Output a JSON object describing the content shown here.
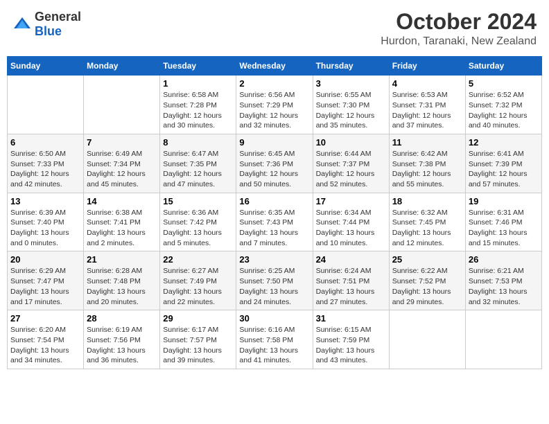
{
  "logo": {
    "general": "General",
    "blue": "Blue"
  },
  "title": "October 2024",
  "subtitle": "Hurdon, Taranaki, New Zealand",
  "header_days": [
    "Sunday",
    "Monday",
    "Tuesday",
    "Wednesday",
    "Thursday",
    "Friday",
    "Saturday"
  ],
  "weeks": [
    [
      {
        "day": "",
        "info": ""
      },
      {
        "day": "",
        "info": ""
      },
      {
        "day": "1",
        "info": "Sunrise: 6:58 AM\nSunset: 7:28 PM\nDaylight: 12 hours and 30 minutes."
      },
      {
        "day": "2",
        "info": "Sunrise: 6:56 AM\nSunset: 7:29 PM\nDaylight: 12 hours and 32 minutes."
      },
      {
        "day": "3",
        "info": "Sunrise: 6:55 AM\nSunset: 7:30 PM\nDaylight: 12 hours and 35 minutes."
      },
      {
        "day": "4",
        "info": "Sunrise: 6:53 AM\nSunset: 7:31 PM\nDaylight: 12 hours and 37 minutes."
      },
      {
        "day": "5",
        "info": "Sunrise: 6:52 AM\nSunset: 7:32 PM\nDaylight: 12 hours and 40 minutes."
      }
    ],
    [
      {
        "day": "6",
        "info": "Sunrise: 6:50 AM\nSunset: 7:33 PM\nDaylight: 12 hours and 42 minutes."
      },
      {
        "day": "7",
        "info": "Sunrise: 6:49 AM\nSunset: 7:34 PM\nDaylight: 12 hours and 45 minutes."
      },
      {
        "day": "8",
        "info": "Sunrise: 6:47 AM\nSunset: 7:35 PM\nDaylight: 12 hours and 47 minutes."
      },
      {
        "day": "9",
        "info": "Sunrise: 6:45 AM\nSunset: 7:36 PM\nDaylight: 12 hours and 50 minutes."
      },
      {
        "day": "10",
        "info": "Sunrise: 6:44 AM\nSunset: 7:37 PM\nDaylight: 12 hours and 52 minutes."
      },
      {
        "day": "11",
        "info": "Sunrise: 6:42 AM\nSunset: 7:38 PM\nDaylight: 12 hours and 55 minutes."
      },
      {
        "day": "12",
        "info": "Sunrise: 6:41 AM\nSunset: 7:39 PM\nDaylight: 12 hours and 57 minutes."
      }
    ],
    [
      {
        "day": "13",
        "info": "Sunrise: 6:39 AM\nSunset: 7:40 PM\nDaylight: 13 hours and 0 minutes."
      },
      {
        "day": "14",
        "info": "Sunrise: 6:38 AM\nSunset: 7:41 PM\nDaylight: 13 hours and 2 minutes."
      },
      {
        "day": "15",
        "info": "Sunrise: 6:36 AM\nSunset: 7:42 PM\nDaylight: 13 hours and 5 minutes."
      },
      {
        "day": "16",
        "info": "Sunrise: 6:35 AM\nSunset: 7:43 PM\nDaylight: 13 hours and 7 minutes."
      },
      {
        "day": "17",
        "info": "Sunrise: 6:34 AM\nSunset: 7:44 PM\nDaylight: 13 hours and 10 minutes."
      },
      {
        "day": "18",
        "info": "Sunrise: 6:32 AM\nSunset: 7:45 PM\nDaylight: 13 hours and 12 minutes."
      },
      {
        "day": "19",
        "info": "Sunrise: 6:31 AM\nSunset: 7:46 PM\nDaylight: 13 hours and 15 minutes."
      }
    ],
    [
      {
        "day": "20",
        "info": "Sunrise: 6:29 AM\nSunset: 7:47 PM\nDaylight: 13 hours and 17 minutes."
      },
      {
        "day": "21",
        "info": "Sunrise: 6:28 AM\nSunset: 7:48 PM\nDaylight: 13 hours and 20 minutes."
      },
      {
        "day": "22",
        "info": "Sunrise: 6:27 AM\nSunset: 7:49 PM\nDaylight: 13 hours and 22 minutes."
      },
      {
        "day": "23",
        "info": "Sunrise: 6:25 AM\nSunset: 7:50 PM\nDaylight: 13 hours and 24 minutes."
      },
      {
        "day": "24",
        "info": "Sunrise: 6:24 AM\nSunset: 7:51 PM\nDaylight: 13 hours and 27 minutes."
      },
      {
        "day": "25",
        "info": "Sunrise: 6:22 AM\nSunset: 7:52 PM\nDaylight: 13 hours and 29 minutes."
      },
      {
        "day": "26",
        "info": "Sunrise: 6:21 AM\nSunset: 7:53 PM\nDaylight: 13 hours and 32 minutes."
      }
    ],
    [
      {
        "day": "27",
        "info": "Sunrise: 6:20 AM\nSunset: 7:54 PM\nDaylight: 13 hours and 34 minutes."
      },
      {
        "day": "28",
        "info": "Sunrise: 6:19 AM\nSunset: 7:56 PM\nDaylight: 13 hours and 36 minutes."
      },
      {
        "day": "29",
        "info": "Sunrise: 6:17 AM\nSunset: 7:57 PM\nDaylight: 13 hours and 39 minutes."
      },
      {
        "day": "30",
        "info": "Sunrise: 6:16 AM\nSunset: 7:58 PM\nDaylight: 13 hours and 41 minutes."
      },
      {
        "day": "31",
        "info": "Sunrise: 6:15 AM\nSunset: 7:59 PM\nDaylight: 13 hours and 43 minutes."
      },
      {
        "day": "",
        "info": ""
      },
      {
        "day": "",
        "info": ""
      }
    ]
  ]
}
